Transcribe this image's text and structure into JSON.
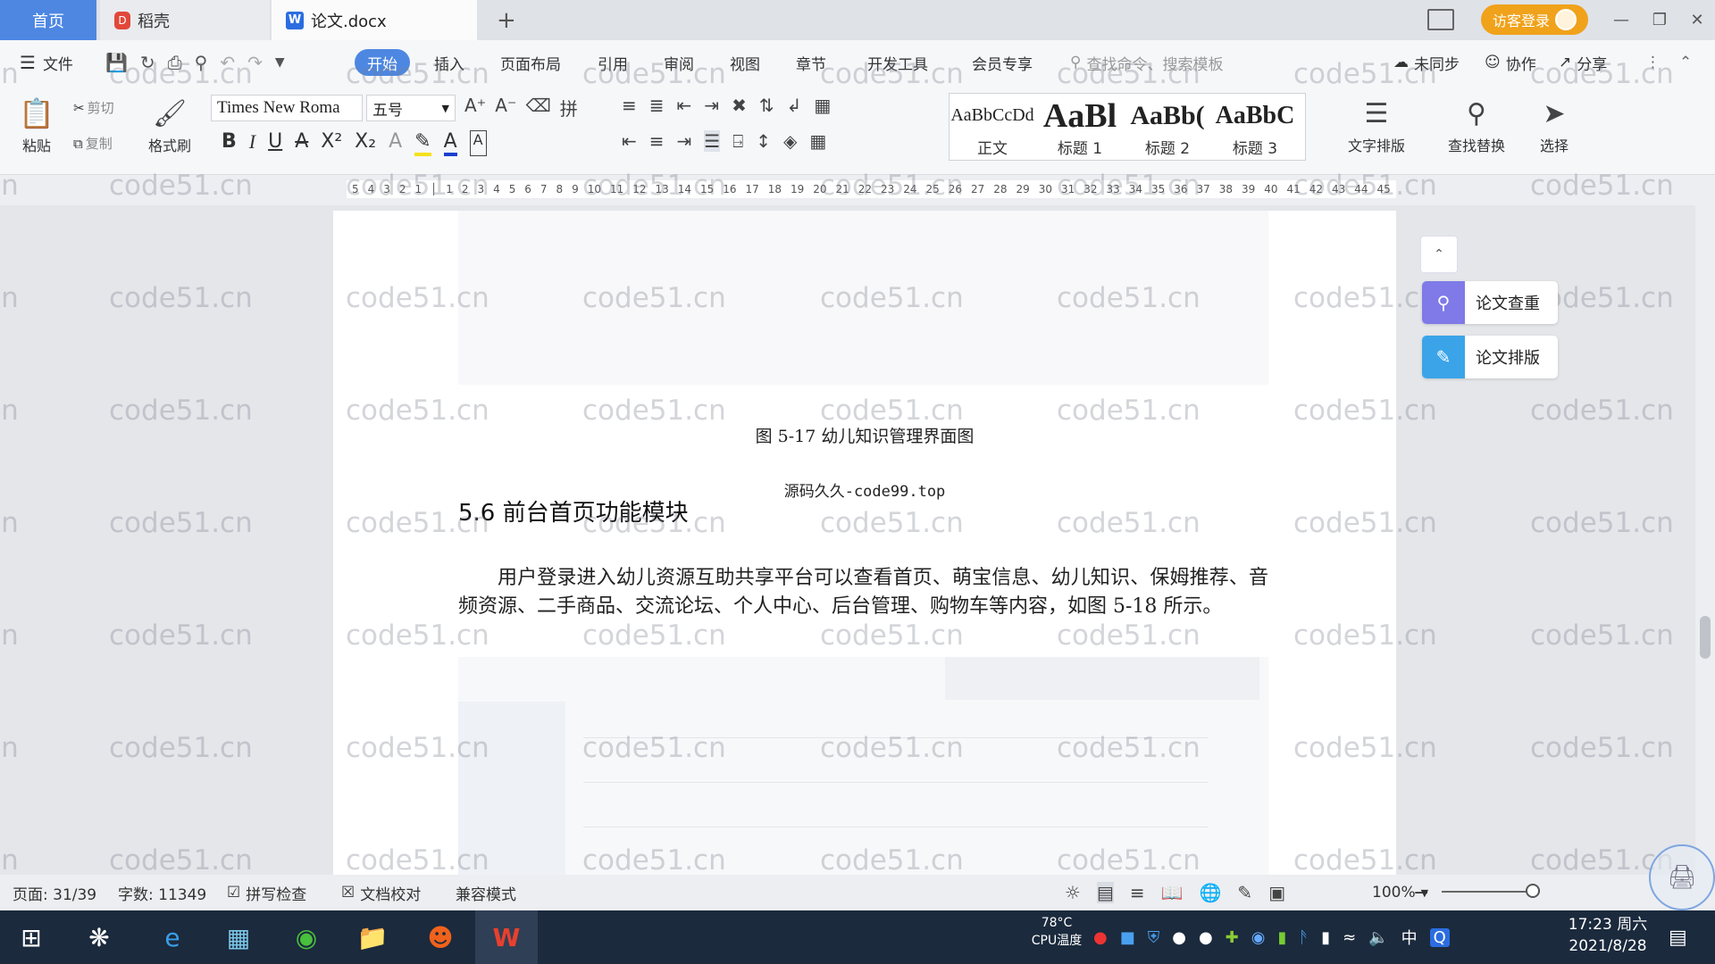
{
  "tabs": {
    "home": "首页",
    "daoke": "稻壳",
    "doc": "论文.docx",
    "add": "+"
  },
  "titlebar": {
    "visitor_login": "访客登录"
  },
  "menu": {
    "file": "文件",
    "start": "开始",
    "insert": "插入",
    "layout": "页面布局",
    "reference": "引用",
    "review": "审阅",
    "view": "视图",
    "chapter": "章节",
    "devtools": "开发工具",
    "member": "会员专享",
    "search_placeholder": "查找命令、搜索模板",
    "unsynced": "未同步",
    "collab": "协作",
    "share": "分享"
  },
  "ribbon": {
    "paste": "粘贴",
    "cut": "剪切",
    "copy": "复制",
    "format_painter": "格式刷",
    "font_name": "Times New Roma",
    "font_size": "五号",
    "styles": [
      {
        "preview": "AaBbCcDd",
        "label": "正文"
      },
      {
        "preview": "AaBl",
        "label": "标题 1"
      },
      {
        "preview": "AaBb(",
        "label": "标题 2"
      },
      {
        "preview": "AaBbC",
        "label": "标题 3"
      }
    ],
    "text_layout": "文字排版",
    "find_replace": "查找替换",
    "select": "选择"
  },
  "ruler": {
    "ticks": [
      "5",
      "4",
      "3",
      "2",
      "1",
      "",
      "1",
      "2",
      "3",
      "4",
      "5",
      "6",
      "7",
      "8",
      "9",
      "10",
      "11",
      "12",
      "13",
      "14",
      "15",
      "16",
      "17",
      "18",
      "19",
      "20",
      "21",
      "22",
      "23",
      "24",
      "25",
      "26",
      "27",
      "28",
      "29",
      "30",
      "31",
      "32",
      "33",
      "34",
      "35",
      "36",
      "37",
      "38",
      "39",
      "40",
      "41",
      "42",
      "43",
      "44",
      "45"
    ]
  },
  "document": {
    "caption": "图 5-17 幼儿知识管理界面图",
    "source": "源码久久-code99.top",
    "heading": "5.6 前台首页功能模块",
    "paragraph": "用户登录进入幼儿资源互助共享平台可以查看首页、萌宝信息、幼儿知识、保姆推荐、音频资源、二手商品、交流论坛、个人中心、后台管理、购物车等内容，如图 5-18 所示。",
    "watermark": "code51.cn"
  },
  "side_panel": {
    "check": "论文查重",
    "format": "论文排版"
  },
  "statusbar": {
    "page": "页面: 31/39",
    "words": "字数: 11349",
    "spell": "拼写检查",
    "proof": "文档校对",
    "compat": "兼容模式",
    "zoom": "100%"
  },
  "taskbar": {
    "cpu_temp": "78°C",
    "cpu_label": "CPU温度",
    "ime": "中",
    "time": "17:23 周六",
    "date": "2021/8/28"
  },
  "colors": {
    "accent": "#4d87e2",
    "visitor": "#f0a21a",
    "taskbar": "#1b2a3d"
  }
}
